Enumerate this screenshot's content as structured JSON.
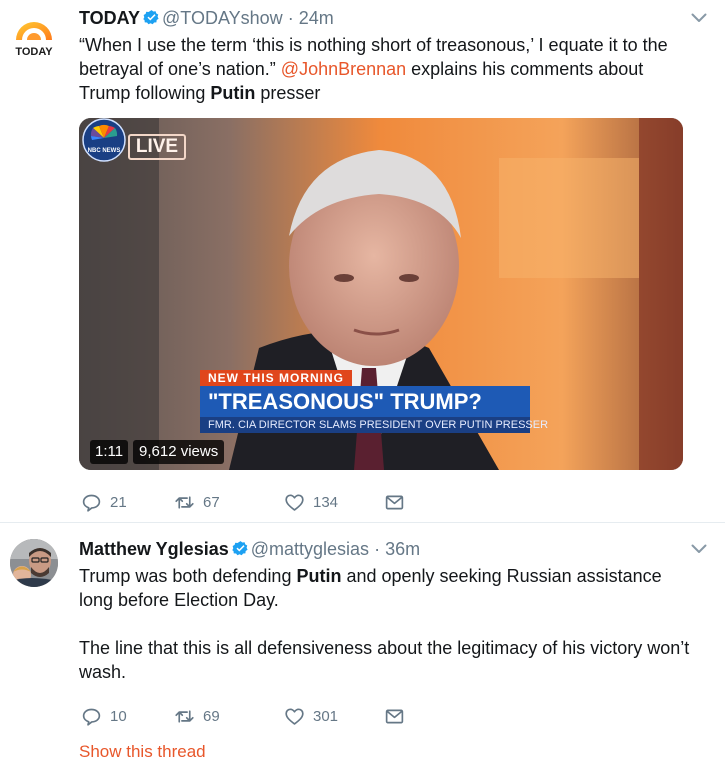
{
  "tweets": [
    {
      "name": "TODAY",
      "handle": "@TODAYshow",
      "separator": "·",
      "time": "24m",
      "avatar_label": "TODAY",
      "text": {
        "part1": "“When I use the term ‘this is nothing short of treasonous,’ I equate it to the betrayal of one’s nation.” ",
        "mention": "@JohnBrennan",
        "part2": " explains his comments about Trump following ",
        "bold": "Putin",
        "part3": " presser"
      },
      "video": {
        "live_tag": "LIVE",
        "chyron_kicker": "NEW THIS MORNING",
        "chyron_main": "\"TREASONOUS\" TRUMP?",
        "chyron_sub": "FMR. CIA DIRECTOR SLAMS PRESIDENT OVER PUTIN PRESSER",
        "network_label": "NBC NEWS",
        "duration": "1:11",
        "views": "9,612 views"
      },
      "actions": {
        "replies": "21",
        "retweets": "67",
        "likes": "134"
      }
    },
    {
      "name": "Matthew Yglesias",
      "handle": "@mattyglesias",
      "separator": "·",
      "time": "36m",
      "text": {
        "p1_a": "Trump was both defending ",
        "p1_bold": "Putin",
        "p1_b": " and openly seeking Russian assistance long before Election Day.",
        "p2": "The line that this is all defensiveness about the legitimacy of his victory won’t wash."
      },
      "actions": {
        "replies": "10",
        "retweets": "69",
        "likes": "301"
      },
      "thread_link": "Show this thread"
    }
  ],
  "colors": {
    "link": "#e8572b",
    "verified": "#1da1f2",
    "muted": "#657786",
    "text": "#14171a"
  },
  "icons": [
    "today-logo-icon",
    "verified-icon",
    "chevron-down-icon",
    "reply-icon",
    "retweet-icon",
    "like-icon",
    "direct-message-icon"
  ]
}
